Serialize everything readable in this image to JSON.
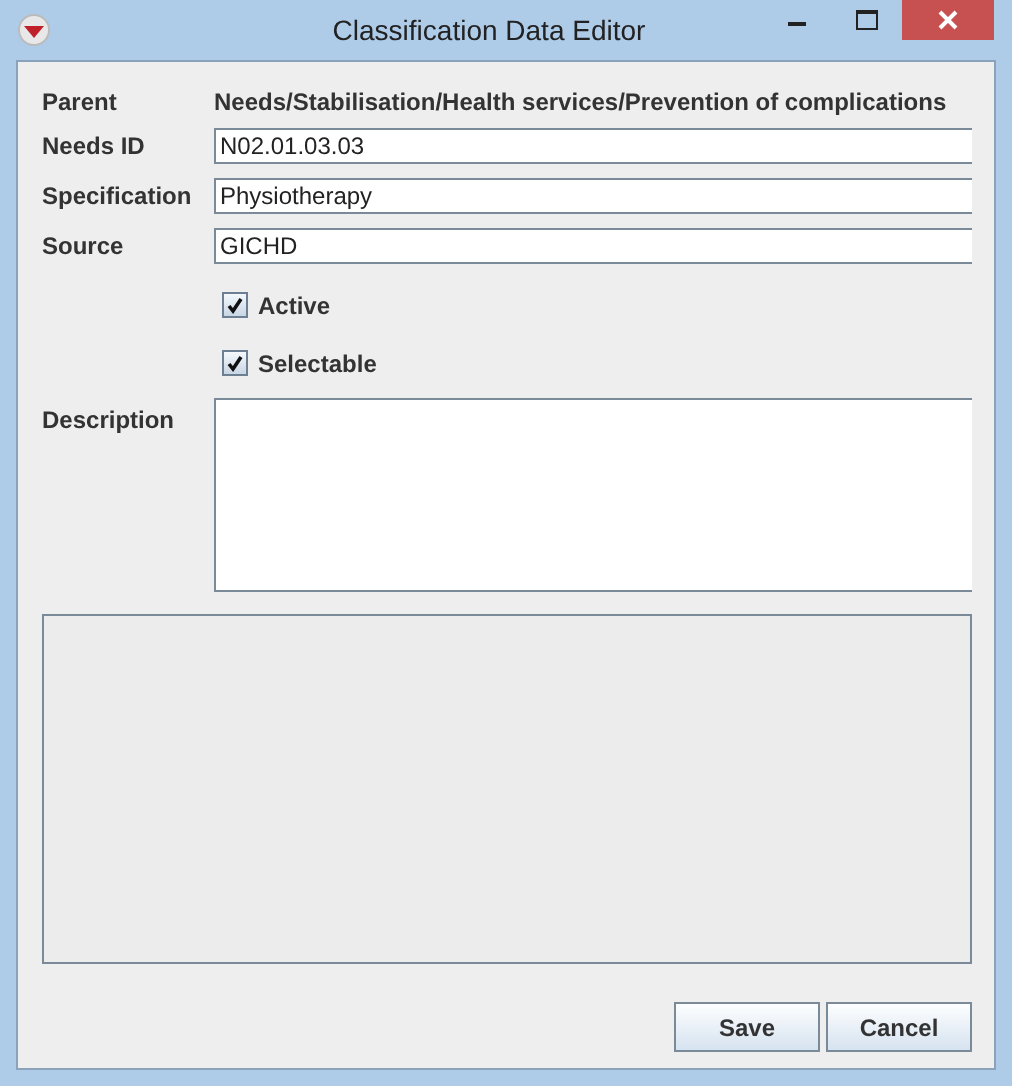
{
  "window": {
    "title": "Classification Data Editor"
  },
  "form": {
    "parent_label": "Parent",
    "parent_value": "Needs/Stabilisation/Health services/Prevention of complications",
    "fields": [
      {
        "label": "Needs ID",
        "value": "N02.01.03.03"
      },
      {
        "label": "Specification",
        "value": "Physiotherapy"
      },
      {
        "label": "Source",
        "value": "GICHD"
      }
    ],
    "checkboxes": [
      {
        "label": "Active",
        "checked": true
      },
      {
        "label": "Selectable",
        "checked": true
      }
    ],
    "description_label": "Description"
  },
  "buttons": [
    "Save",
    "Cancel"
  ]
}
